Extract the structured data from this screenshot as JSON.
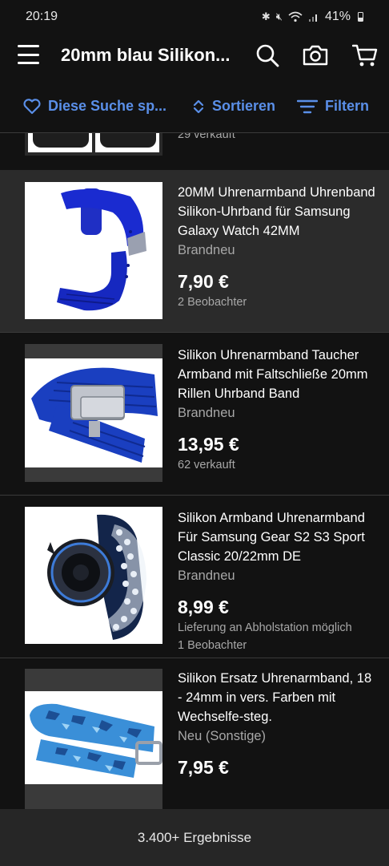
{
  "status_bar": {
    "time": "20:19",
    "battery": "41%"
  },
  "app_bar": {
    "title": "20mm blau Silikon..."
  },
  "toolbar": {
    "save_search": "Diese Suche sp...",
    "sort": "Sortieren",
    "filter": "Filtern"
  },
  "partial_item": {
    "sold": "29 verkauft"
  },
  "items": [
    {
      "title": "20MM Uhrenarmband Uhrenband Silikon-Uhrband für Samsung Galaxy Watch 42MM",
      "condition": "Brandneu",
      "price": "7,90 €",
      "meta1": "2 Beobachter",
      "meta2": ""
    },
    {
      "title": "Silikon Uhrenarmband Taucher Armband mit Faltschließe 20mm Rillen Uhrband Band",
      "condition": "Brandneu",
      "price": "13,95 €",
      "meta1": "62 verkauft",
      "meta2": ""
    },
    {
      "title": "Silikon Armband Uhrenarmband Für Samsung Gear S2 S3 Sport Classic 20/22mm DE",
      "condition": "Brandneu",
      "price": "8,99 €",
      "meta1": "Lieferung an Abholstation möglich",
      "meta2": "1 Beobachter"
    },
    {
      "title": "Silikon Ersatz Uhrenarmband, 18 - 24mm in vers. Farben mit Wechselfe-steg.",
      "condition": "Neu (Sonstige)",
      "price": "7,95 €",
      "meta1": "",
      "meta2": ""
    }
  ],
  "bottom_bar": {
    "results": "3.400+ Ergebnisse"
  },
  "colors": {
    "accent": "#5a8fe8",
    "background": "#121212",
    "highlight_row": "#2b2b2b"
  }
}
